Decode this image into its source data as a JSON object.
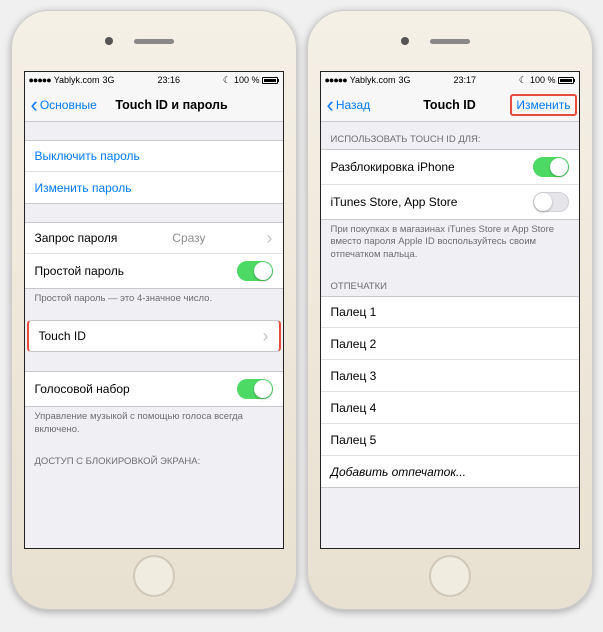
{
  "left": {
    "status": {
      "carrier": "Yablyk.com",
      "network": "3G",
      "time": "23:16",
      "battery": "100 %"
    },
    "nav": {
      "back": "Основные",
      "title": "Touch ID и пароль"
    },
    "rows": {
      "turnoff": "Выключить пароль",
      "change": "Изменить пароль",
      "require": "Запрос пароля",
      "require_val": "Сразу",
      "simple": "Простой пароль",
      "simple_note": "Простой пароль — это 4-значное число.",
      "touchid": "Touch ID",
      "voice": "Голосовой набор",
      "voice_note": "Управление музыкой с помощью голоса всегда включено.",
      "lockaccess": "ДОСТУП С БЛОКИРОВКОЙ ЭКРАНА:"
    }
  },
  "right": {
    "status": {
      "carrier": "Yablyk.com",
      "network": "3G",
      "time": "23:17",
      "battery": "100 %"
    },
    "nav": {
      "back": "Назад",
      "title": "Touch ID",
      "edit": "Изменить"
    },
    "headers": {
      "use": "ИСПОЛЬЗОВАТЬ TOUCH ID ДЛЯ:",
      "prints": "ОТПЕЧАТКИ"
    },
    "rows": {
      "unlock": "Разблокировка iPhone",
      "itunes": "iTunes Store, App Store",
      "note": "При покупках в магазинах iTunes Store и App Store вместо пароля Apple ID воспользуйтесь своим отпечатком пальца.",
      "f1": "Палец 1",
      "f2": "Палец 2",
      "f3": "Палец 3",
      "f4": "Палец 4",
      "f5": "Палец 5",
      "add": "Добавить отпечаток..."
    }
  }
}
